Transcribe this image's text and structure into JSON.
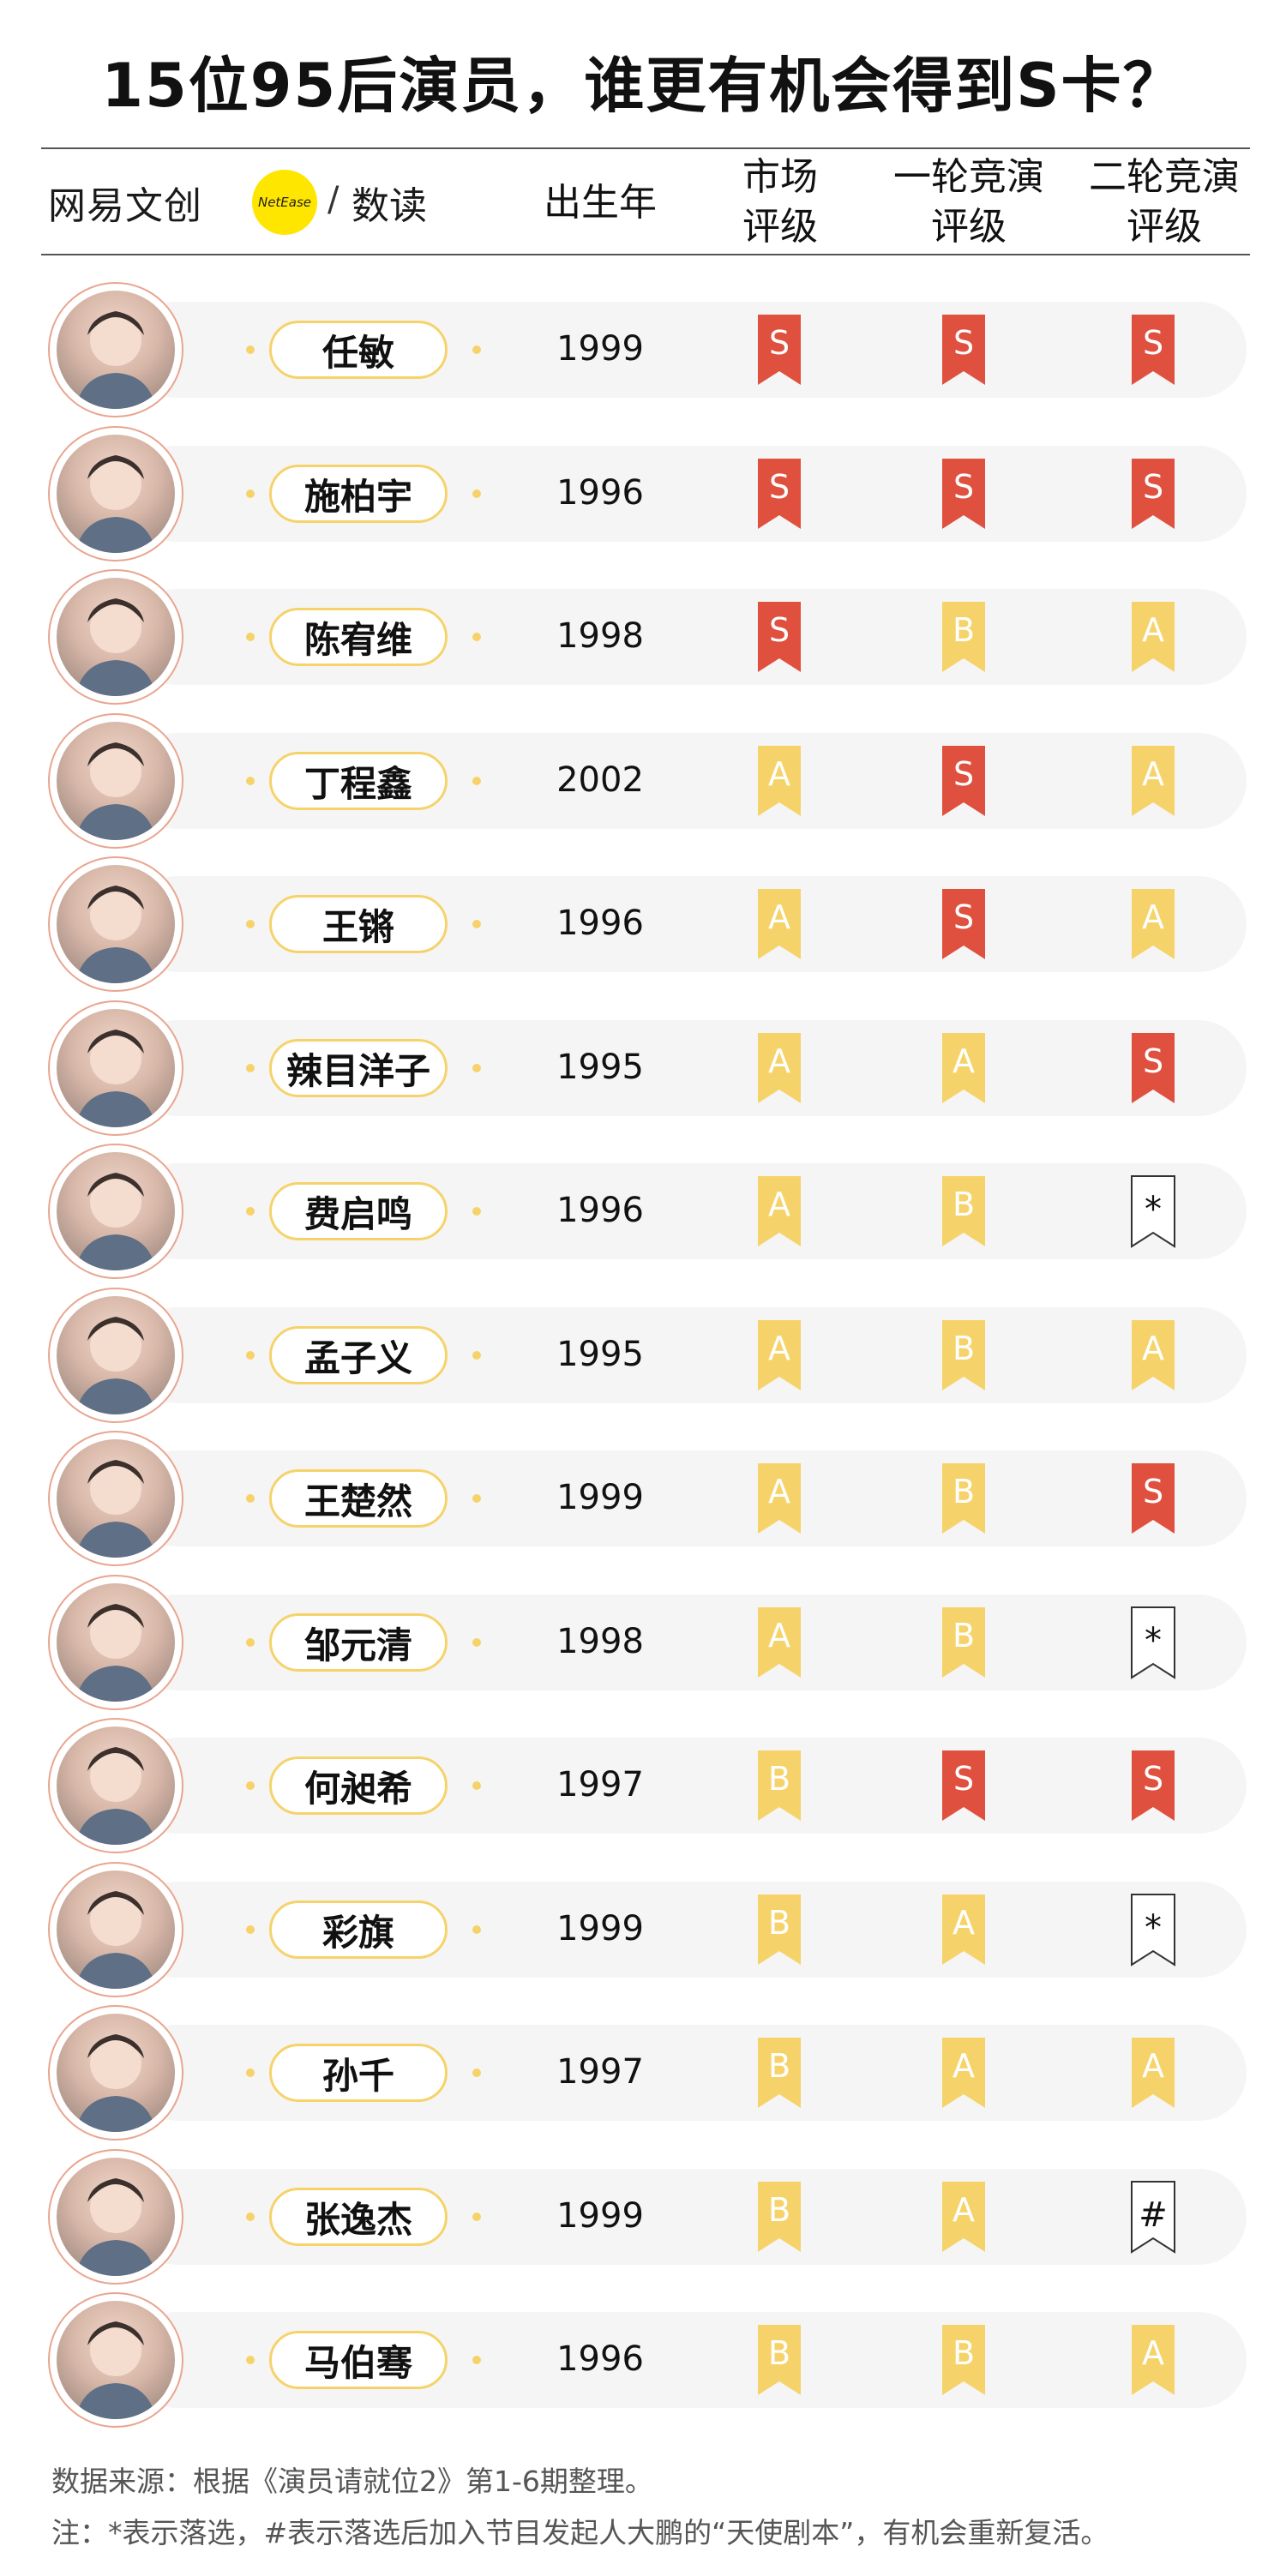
{
  "title": "15位95后演员，谁更有机会得到S卡？",
  "brand": {
    "name": "网易文创",
    "dot_text": "NetEase",
    "slash": "/",
    "sub": "数读"
  },
  "headers": {
    "birth_year": "出生年",
    "market_l1": "市场",
    "market_l2": "评级",
    "round1_l1": "一轮竞演",
    "round1_l2": "评级",
    "round2_l1": "二轮竞演",
    "round2_l2": "评级"
  },
  "colors": {
    "S": "#e0503f",
    "A": "#f6d36a",
    "B": "#f6d36a",
    "outline": "#ffffff",
    "pill_border": "#f6d36a",
    "avatar_border": "#e9a58f"
  },
  "rows": [
    {
      "name": "任敏",
      "year": "1999",
      "market": "S",
      "round1": "S",
      "round2": "S"
    },
    {
      "name": "施柏宇",
      "year": "1996",
      "market": "S",
      "round1": "S",
      "round2": "S"
    },
    {
      "name": "陈宥维",
      "year": "1998",
      "market": "S",
      "round1": "B",
      "round2": "A"
    },
    {
      "name": "丁程鑫",
      "year": "2002",
      "market": "A",
      "round1": "S",
      "round2": "A"
    },
    {
      "name": "王锵",
      "year": "1996",
      "market": "A",
      "round1": "S",
      "round2": "A"
    },
    {
      "name": "辣目洋子",
      "year": "1995",
      "market": "A",
      "round1": "A",
      "round2": "S"
    },
    {
      "name": "费启鸣",
      "year": "1996",
      "market": "A",
      "round1": "B",
      "round2": "*"
    },
    {
      "name": "孟子义",
      "year": "1995",
      "market": "A",
      "round1": "B",
      "round2": "A"
    },
    {
      "name": "王楚然",
      "year": "1999",
      "market": "A",
      "round1": "B",
      "round2": "S"
    },
    {
      "name": "邹元清",
      "year": "1998",
      "market": "A",
      "round1": "B",
      "round2": "*"
    },
    {
      "name": "何昶希",
      "year": "1997",
      "market": "B",
      "round1": "S",
      "round2": "S"
    },
    {
      "name": "彩旗",
      "year": "1999",
      "market": "B",
      "round1": "A",
      "round2": "*"
    },
    {
      "name": "孙千",
      "year": "1997",
      "market": "B",
      "round1": "A",
      "round2": "A"
    },
    {
      "name": "张逸杰",
      "year": "1999",
      "market": "B",
      "round1": "A",
      "round2": "#"
    },
    {
      "name": "马伯骞",
      "year": "1996",
      "market": "B",
      "round1": "B",
      "round2": "A"
    }
  ],
  "footer": {
    "source": "数据来源：根据《演员请就位2》第1-6期整理。",
    "note": "注：*表示落选，#表示落选后加入节目发起人大鹏的“天使剧本”，有机会重新复活。"
  }
}
